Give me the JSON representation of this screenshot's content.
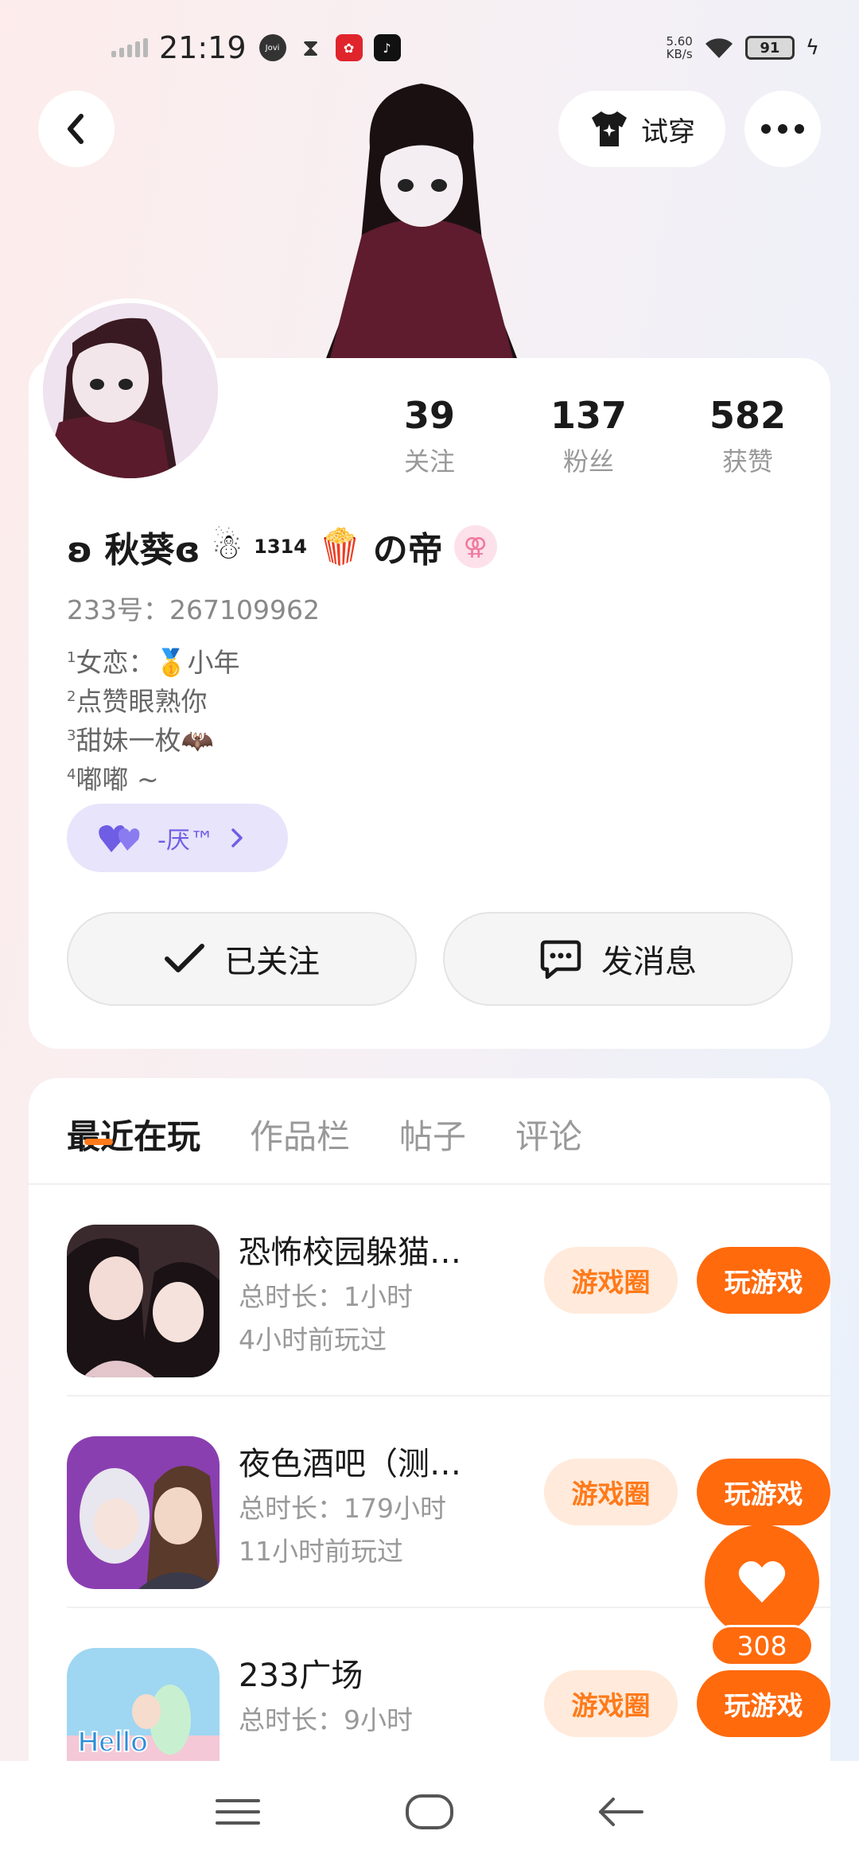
{
  "status_bar": {
    "time": "21:19",
    "small_icon_label": "Jovi",
    "net_speed_value": "5.60",
    "net_speed_unit": "KB/s",
    "battery": "91"
  },
  "header": {
    "try_on_label": "试穿"
  },
  "profile": {
    "stats": [
      {
        "num": "39",
        "label": "关注"
      },
      {
        "num": "137",
        "label": "粉丝"
      },
      {
        "num": "582",
        "label": "获赞"
      }
    ],
    "name_prefix": "ʚ 秋葵ɞ",
    "name_snowman": "☃",
    "name_sup": "1314",
    "name_popcorn": "🍿",
    "name_suffix": "の帝",
    "gender_symbol": "⚢",
    "user_id": "233号：267109962",
    "bio": [
      {
        "sup": "1",
        "text": "女恋：🥇小年"
      },
      {
        "sup": "2",
        "text": "点赞眼熟你"
      },
      {
        "sup": "3",
        "text": "甜妹一枚🦇"
      },
      {
        "sup": "4",
        "text": "嘟嘟 ~"
      }
    ],
    "tag_label": "-厌™",
    "follow_label": "已关注",
    "message_label": "发消息"
  },
  "tabs": [
    {
      "label": "最近在玩",
      "active": true
    },
    {
      "label": "作品栏",
      "active": false
    },
    {
      "label": "帖子",
      "active": false
    },
    {
      "label": "评论",
      "active": false
    }
  ],
  "games": [
    {
      "title": "恐怖校园躲猫…",
      "duration": "总时长：1小时",
      "last_played": "4小时前玩过",
      "circle_label": "游戏圈",
      "play_label": "玩游戏"
    },
    {
      "title": "夜色酒吧（测…",
      "duration": "总时长：179小时",
      "last_played": "11小时前玩过",
      "circle_label": "游戏圈",
      "play_label": "玩游戏"
    },
    {
      "title": "233广场",
      "duration": "总时长：9小时",
      "last_played": "",
      "circle_label": "游戏圈",
      "play_label": "玩游戏",
      "icon_text": "Hello"
    }
  ],
  "float_like": {
    "count": "308"
  },
  "colors": {
    "accent": "#ff6a0d",
    "accent_light": "#ffeadb",
    "tag_bg": "#e7e4fb",
    "tag_fg": "#6f5de4"
  }
}
